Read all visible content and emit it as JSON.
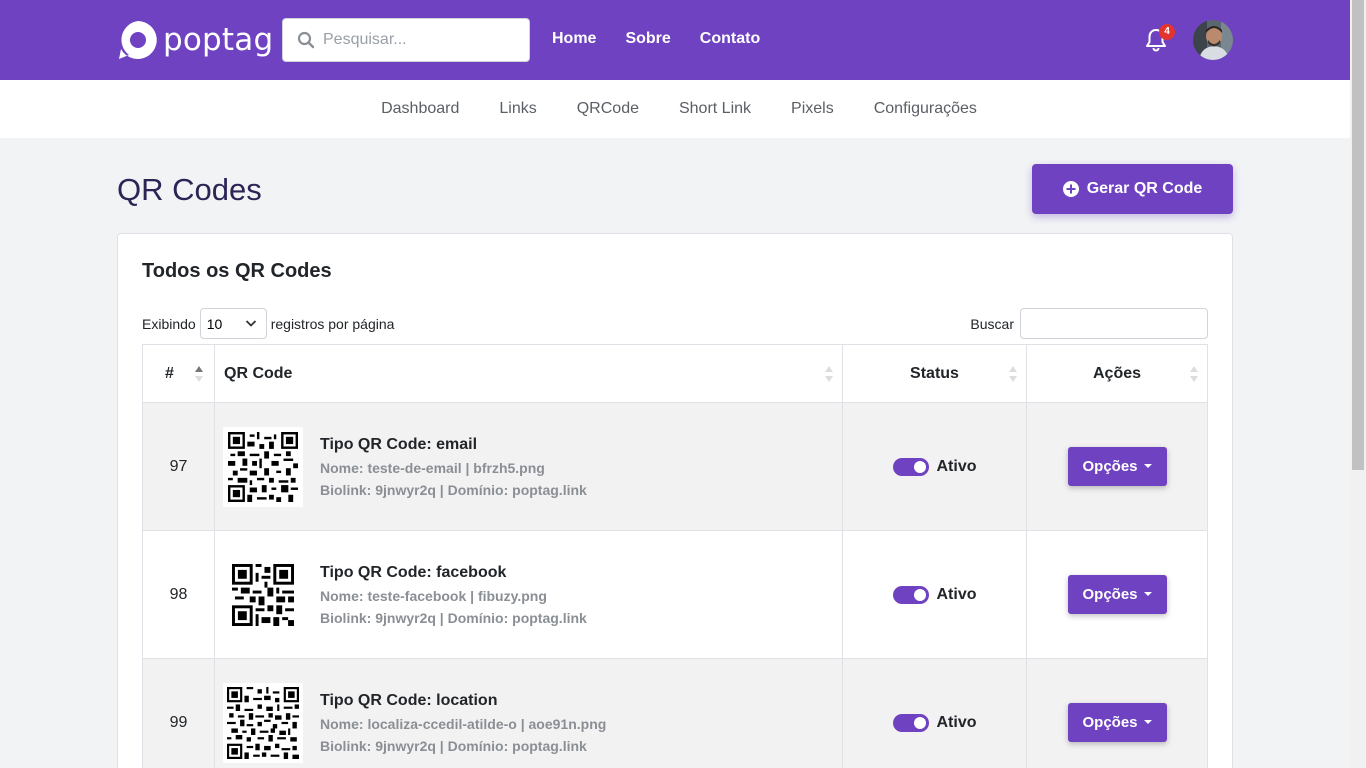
{
  "header": {
    "logo_text": "poptag",
    "search_placeholder": "Pesquisar...",
    "nav": [
      "Home",
      "Sobre",
      "Contato"
    ],
    "notification_count": "4"
  },
  "subnav": [
    "Dashboard",
    "Links",
    "QRCode",
    "Short Link",
    "Pixels",
    "Configurações"
  ],
  "page": {
    "title": "QR Codes",
    "generate_label": "Gerar QR Code"
  },
  "card": {
    "title": "Todos os QR Codes",
    "length_prefix": "Exibindo",
    "length_value": "10",
    "length_suffix": "registros por página",
    "search_label": "Buscar"
  },
  "table": {
    "headers": [
      "#",
      "QR Code",
      "Status",
      "Ações"
    ],
    "rows": [
      {
        "id": "97",
        "type": "Tipo QR Code: email",
        "name": "Nome: teste-de-email | bfrzh5.png",
        "biolink": "Biolink: 9jnwyr2q | Domínio: poptag.link",
        "status": "Ativo",
        "action": "Opções"
      },
      {
        "id": "98",
        "type": "Tipo QR Code: facebook",
        "name": "Nome: teste-facebook | fibuzy.png",
        "biolink": "Biolink: 9jnwyr2q | Domínio: poptag.link",
        "status": "Ativo",
        "action": "Opções"
      },
      {
        "id": "99",
        "type": "Tipo QR Code: location",
        "name": "Nome: localiza-ccedil-atilde-o | aoe91n.png",
        "biolink": "Biolink: 9jnwyr2q | Domínio: poptag.link",
        "status": "Ativo",
        "action": "Opções"
      }
    ]
  },
  "colors": {
    "brand": "#6f42c1",
    "badge": "#e3342f"
  }
}
